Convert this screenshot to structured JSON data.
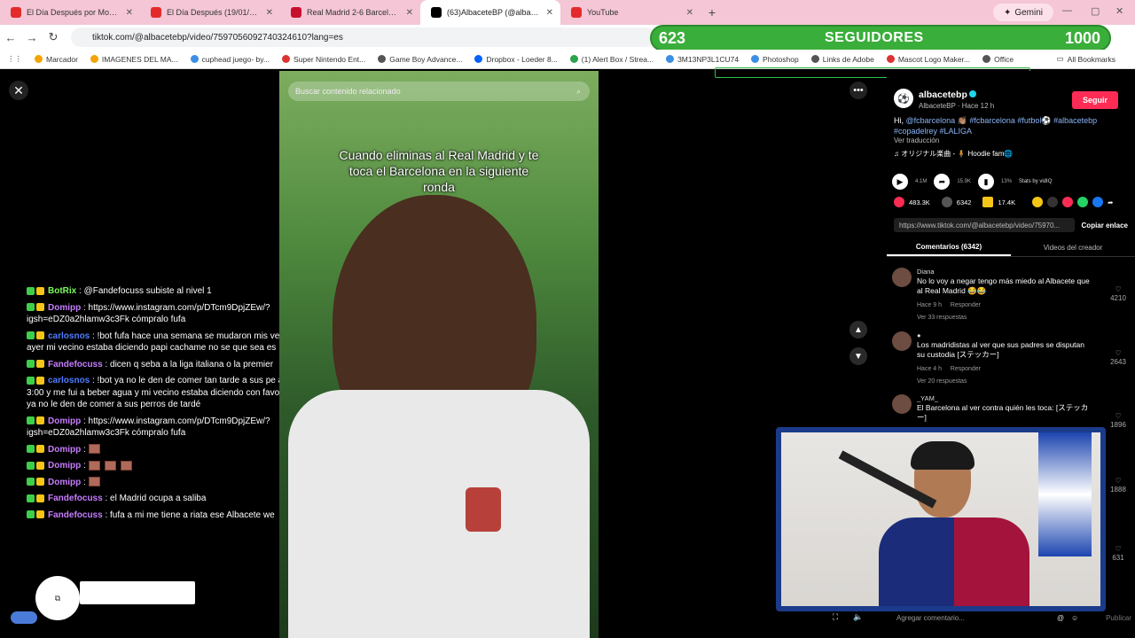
{
  "tabs": [
    {
      "label": "El Día Después por Movistar Pl",
      "color": "#e32b2b",
      "active": false
    },
    {
      "label": "El Día Después (19/01/2026): C",
      "color": "#e32b2b",
      "active": false
    },
    {
      "label": "Real Madrid 2-6 Barcelona (2 d",
      "color": "#c8102e",
      "active": false
    },
    {
      "label": "(63)AlbaceteBP (@albacete",
      "color": "#000000",
      "active": true
    },
    {
      "label": "YouTube",
      "color": "#e32b2b",
      "active": false
    }
  ],
  "browser": {
    "url": "tiktok.com/@albacetebp/video/7597056092740324610?lang=es",
    "gemini": "Gemini",
    "bookmarks": [
      {
        "label": "Marcador",
        "color": "#f4a300"
      },
      {
        "label": "IMAGENES DEL MA...",
        "color": "#f4a300"
      },
      {
        "label": "cuphead juego- by...",
        "color": "#3d8ee6"
      },
      {
        "label": "Super Nintendo Ent...",
        "color": "#d33"
      },
      {
        "label": "Game Boy Advance...",
        "color": "#555"
      },
      {
        "label": "Dropbox - Loeder 8...",
        "color": "#0061ff"
      },
      {
        "label": "(1) Alert Box / Strea...",
        "color": "#2ba34a"
      },
      {
        "label": "3M13NP3L1CU74",
        "color": "#3d8ee6"
      },
      {
        "label": "Photoshop",
        "color": "#3d8ee6"
      },
      {
        "label": "Links de Adobe",
        "color": "#555"
      },
      {
        "label": "Mascot Logo Maker...",
        "color": "#d33"
      },
      {
        "label": "Office",
        "color": "#555"
      }
    ],
    "all_bookmarks": "All Bookmarks"
  },
  "overlay": {
    "count": "623",
    "label": "SEGUIDORES",
    "target": "1000"
  },
  "chat": [
    {
      "user": "BotRix",
      "color": "#7cfc5a",
      "text": ": @Fandefocuss subiste al nivel 1",
      "emotes": 0
    },
    {
      "user": "Domipp",
      "color": "#c77dff",
      "text": ": https://www.instagram.com/p/DTcm9DpjZEw/?igsh=eDZ0a2hlamw3c3Fk cómpralo fufa",
      "emotes": 0
    },
    {
      "user": "carlosnos",
      "color": "#4f7cff",
      "text": ": !bot fufa hace una semana se mudaron mis ve ayer mi vecino estaba diciendo papi cachame no se que sea es",
      "emotes": 0
    },
    {
      "user": "Fandefocuss",
      "color": "#c77dff",
      "text": ": dicen q seba a la liga italiana o la premier",
      "emotes": 0
    },
    {
      "user": "carlosnos",
      "color": "#4f7cff",
      "text": ": !bot ya no le den de comer tan tarde a sus pe ala 3:00 y me fui a beber agua y mi vecino estaba diciendo con favor ya no le den de comer a sus perros de tardé",
      "emotes": 0
    },
    {
      "user": "Domipp",
      "color": "#c77dff",
      "text": ": https://www.instagram.com/p/DTcm9DpjZEw/?igsh=eDZ0a2hlamw3c3Fk cómpralo fufa",
      "emotes": 0
    },
    {
      "user": "Domipp",
      "color": "#c77dff",
      "text": ":",
      "emotes": 1
    },
    {
      "user": "Domipp",
      "color": "#c77dff",
      "text": ":",
      "emotes": 3
    },
    {
      "user": "Domipp",
      "color": "#c77dff",
      "text": ":",
      "emotes": 1
    },
    {
      "user": "Fandefocuss",
      "color": "#c77dff",
      "text": ": el Madrid ocupa a saliba",
      "emotes": 0
    },
    {
      "user": "Fandefocuss",
      "color": "#c77dff",
      "text": ": fufa a mi me tiene a riata ese Albacete we",
      "emotes": 0
    }
  ],
  "video": {
    "search_placeholder": "Buscar contenido relacionado",
    "caption": "Cuando eliminas al Real Madrid y te toca el Barcelona en la siguiente ronda"
  },
  "panel": {
    "username": "albacetebp",
    "subline": "AlbaceteBP · Hace 12 h",
    "follow": "Seguir",
    "desc_prefix": "Hi, ",
    "desc_tags": "@fcbarcelona 👏🏽 #fcbarcelona #futbol⚽ #albacetebp #copadelrey #LALIGA",
    "translate": "Ver traducción",
    "music": "♫ オリジナル楽曲 - 🧍 Hoodie fam🌐",
    "play_stats": [
      "4.1M",
      "15.9K",
      "13%"
    ],
    "stats_by": "Stats by vidIQ",
    "likes": "483.3K",
    "comments_count": "6342",
    "saves": "17.4K",
    "link": "https://www.tiktok.com/@albacetebp/video/75970...",
    "copy_link": "Copiar enlace",
    "tab_comments": "Comentarios (6342)",
    "tab_videos": "Videos del creador",
    "comments": [
      {
        "name": "Diana",
        "text": "No lo voy a negar tengo más miedo al Albacete que al Real Madrid 😂😂",
        "meta": "Hace 9 h",
        "reply": "Responder",
        "replies": "Ver 33 respuestas",
        "likes": "4210"
      },
      {
        "name": "●",
        "text": "Los madridistas al ver que sus padres se disputan su custodia [ステッカー]",
        "meta": "Hace 4 h",
        "reply": "Responder",
        "replies": "Ver 20 respuestas",
        "likes": "2643"
      },
      {
        "name": "_YAM_",
        "text": "El Barcelona al ver contra quién les toca: [ステッカー]",
        "meta": "",
        "reply": "",
        "replies": "",
        "likes": "1896"
      }
    ],
    "extra_likes": [
      "1888",
      "631"
    ],
    "add_comment": "Agregar comentario...",
    "publish": "Publicar"
  }
}
